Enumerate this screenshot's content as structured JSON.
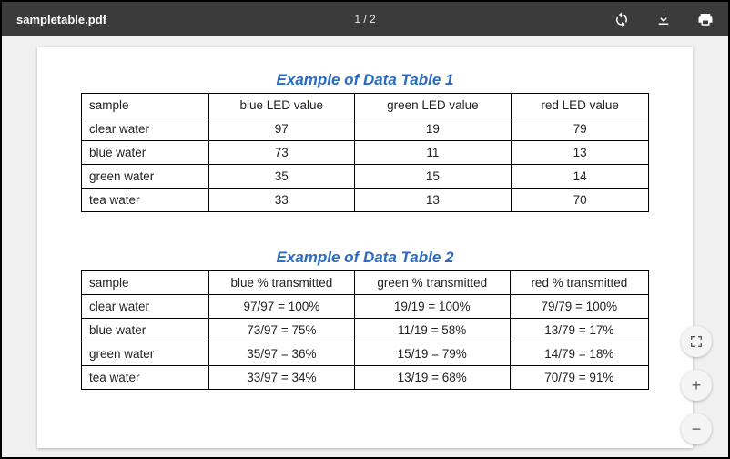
{
  "toolbar": {
    "file_name": "sampletable.pdf",
    "page_indicator": "1 / 2"
  },
  "table1": {
    "title": "Example of Data Table 1",
    "headers": [
      "sample",
      "blue LED value",
      "green LED value",
      "red LED value"
    ],
    "rows": [
      {
        "sample": "clear water",
        "blue": "97",
        "green": "19",
        "red": "79"
      },
      {
        "sample": "blue water",
        "blue": "73",
        "green": "11",
        "red": "13"
      },
      {
        "sample": "green water",
        "blue": "35",
        "green": "15",
        "red": "14"
      },
      {
        "sample": "tea water",
        "blue": "33",
        "green": "13",
        "red": "70"
      }
    ]
  },
  "table2": {
    "title": "Example of Data Table 2",
    "headers": [
      "sample",
      "blue % transmitted",
      "green % transmitted",
      "red % transmitted"
    ],
    "rows": [
      {
        "sample": "clear water",
        "blue": "97/97 = 100%",
        "green": "19/19 = 100%",
        "red": "79/79 = 100%"
      },
      {
        "sample": "blue water",
        "blue": "73/97 = 75%",
        "green": "11/19 = 58%",
        "red": "13/79 = 17%"
      },
      {
        "sample": "green water",
        "blue": "35/97 = 36%",
        "green": "15/19 = 79%",
        "red": "14/79 = 18%"
      },
      {
        "sample": "tea water",
        "blue": "33/97 = 34%",
        "green": "13/19 = 68%",
        "red": "70/79 = 91%"
      }
    ]
  },
  "controls": {
    "zoom_in": "+",
    "zoom_out": "−"
  }
}
